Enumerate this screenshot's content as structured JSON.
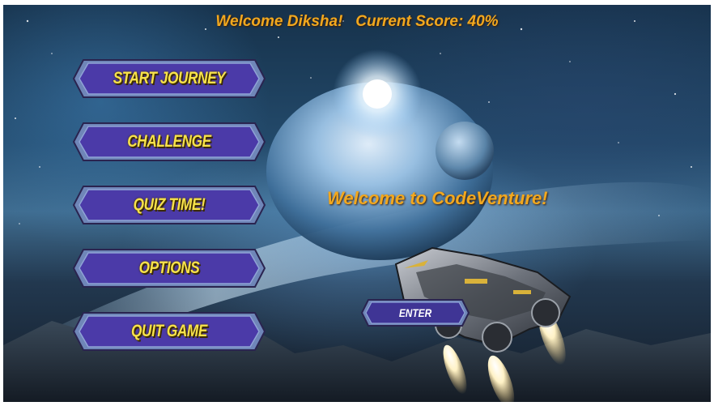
{
  "header": {
    "greeting": "Welcome Diksha!   Current Score: 40%"
  },
  "menu": {
    "items": [
      {
        "label": "START JOURNEY"
      },
      {
        "label": "CHALLENGE"
      },
      {
        "label": "QUIZ TIME!"
      },
      {
        "label": "OPTIONS"
      },
      {
        "label": "QUIT GAME"
      }
    ]
  },
  "main": {
    "welcome": "Welcome to CodeVenture!",
    "enter_label": "ENTER"
  },
  "colors": {
    "accent_text": "#f2a81e",
    "button_label": "#f7e24a",
    "button_fill": "#4b3aa8"
  }
}
